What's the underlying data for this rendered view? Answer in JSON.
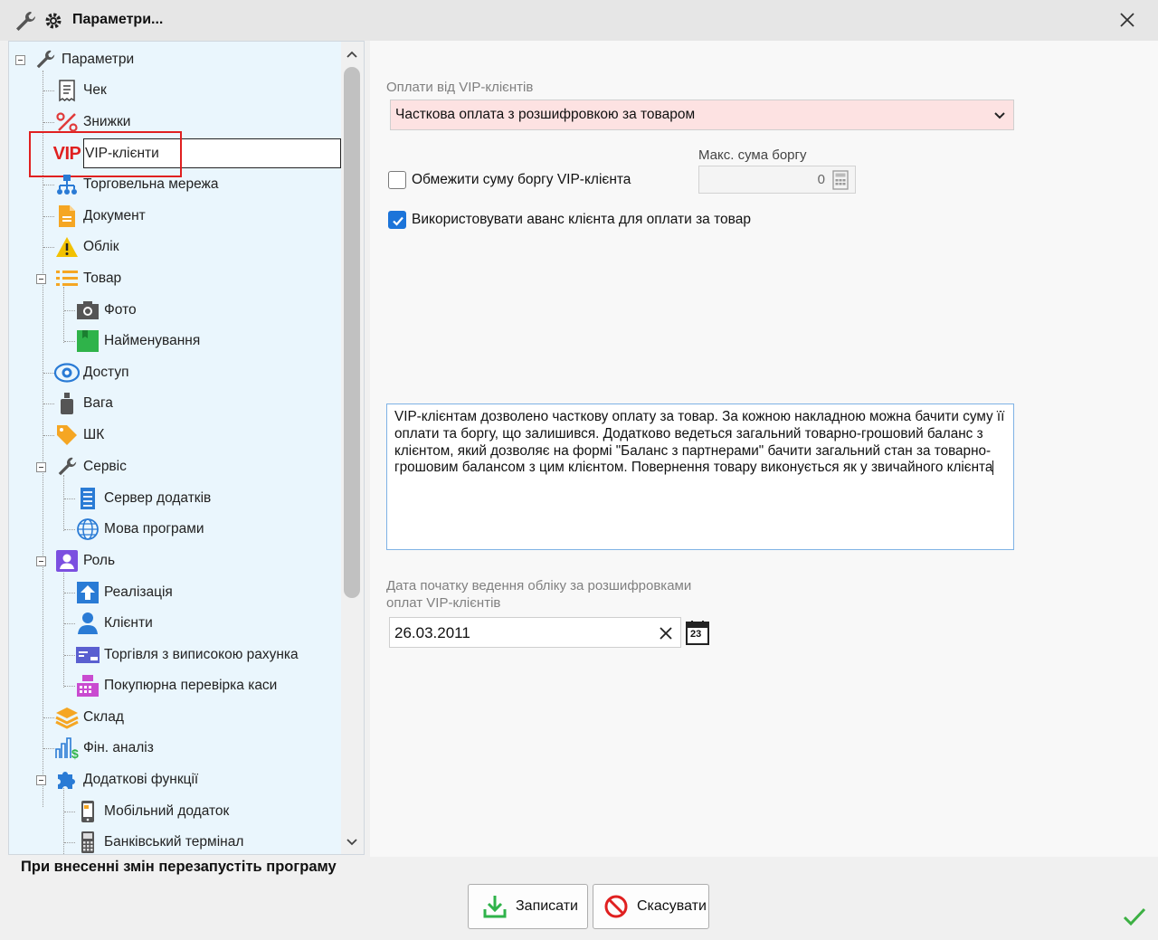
{
  "window": {
    "title": "Параметри..."
  },
  "tree": {
    "items": [
      {
        "label": "Параметри",
        "icon": "wrench-icon"
      },
      {
        "label": "Чек",
        "icon": "receipt-icon"
      },
      {
        "label": "Знижки",
        "icon": "percent-icon"
      },
      {
        "label": "VIP-клієнти",
        "icon": "vip-icon",
        "icon_text": "VIP",
        "selected": true
      },
      {
        "label": "Торговельна мережа",
        "icon": "network-icon"
      },
      {
        "label": "Документ",
        "icon": "document-icon"
      },
      {
        "label": "Облік",
        "icon": "warning-icon"
      },
      {
        "label": "Товар",
        "icon": "list-icon"
      },
      {
        "label": "Фото",
        "icon": "camera-icon"
      },
      {
        "label": "Найменування",
        "icon": "name-icon"
      },
      {
        "label": "Доступ",
        "icon": "eye-icon"
      },
      {
        "label": "Вага",
        "icon": "weight-icon"
      },
      {
        "label": "ШК",
        "icon": "tag-icon"
      },
      {
        "label": "Сервіс",
        "icon": "wrench-icon"
      },
      {
        "label": "Сервер додатків",
        "icon": "server-icon"
      },
      {
        "label": "Мова програми",
        "icon": "globe-icon"
      },
      {
        "label": "Роль",
        "icon": "user-card-icon"
      },
      {
        "label": "Реалізація",
        "icon": "upload-icon"
      },
      {
        "label": "Клієнти",
        "icon": "person-icon"
      },
      {
        "label": "Торгівля з виписокою рахунка",
        "icon": "card-icon"
      },
      {
        "label": "Покупюрна перевірка каси",
        "icon": "cash-register-icon"
      },
      {
        "label": "Склад",
        "icon": "layers-icon"
      },
      {
        "label": "Фін. аналіз",
        "icon": "finance-chart-icon"
      },
      {
        "label": "Додаткові функції",
        "icon": "puzzle-icon"
      },
      {
        "label": "Мобільний додаток",
        "icon": "mobile-icon"
      },
      {
        "label": "Банківський термінал",
        "icon": "terminal-icon"
      }
    ]
  },
  "settings": {
    "payments_label": "Оплати від VIP-клієнтів",
    "payments_value": "Часткова оплата з розшифровкою за товаром",
    "max_debt_label": "Макс. сума боргу",
    "max_debt_value": "0",
    "limit_debt_label": "Обмежити суму боргу VIP-клієнта",
    "limit_debt_checked": false,
    "use_advance_label": "Використовувати аванс клієнта для оплати за товар",
    "use_advance_checked": true,
    "description": "VIP-клієнтам дозволено часткову оплату за товар. За кожною накладною можна бачити суму її оплати та боргу, що залишився. Додатково ведеться загальний товарно-грошовий баланс з клієнтом, який дозволяє на формі \"Баланс з партнерами\" бачити загальний стан за товарно-грошовим балансом з цим клієнтом. Повернення товару виконується як у звичайного клієнта",
    "date_label_line1": "Дата початку ведення обліку за розшифровками",
    "date_label_line2": "оплат VIP-клієнтів",
    "date_value": "26.03.2011",
    "calendar_badge": "23"
  },
  "footer": {
    "restart_note": "При внесенні змін перезапустіть програму",
    "save_label": "Записати",
    "cancel_label": "Скасувати"
  },
  "colors": {
    "accent": "#1c74d9",
    "dropdown_bg": "#fde2e2",
    "selection_outline": "#e02020",
    "ok_green": "#3cb043"
  }
}
